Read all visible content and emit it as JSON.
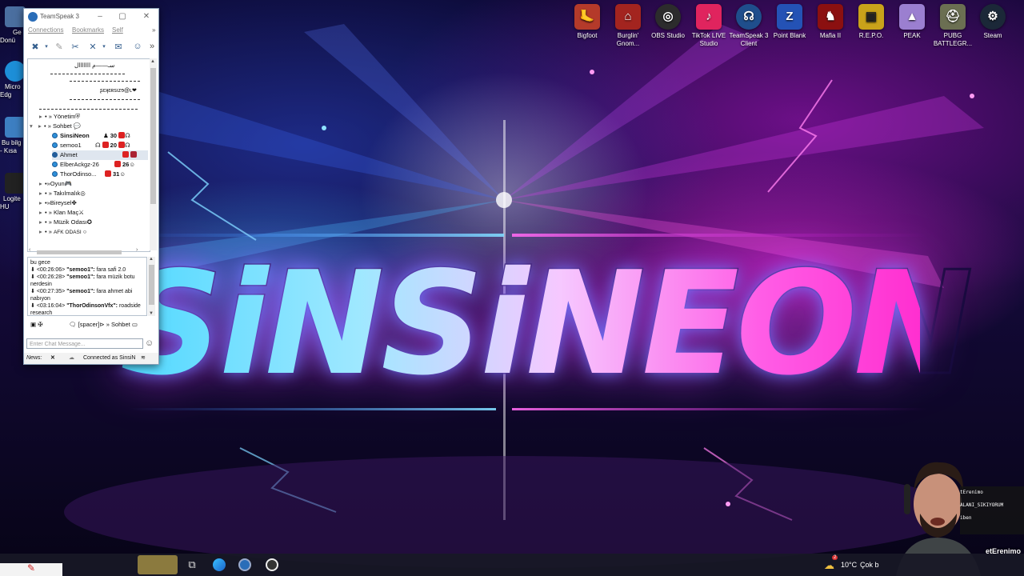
{
  "desktop": {
    "left_icons": [
      {
        "label": "Ge Donü",
        "icon": "app-icon"
      },
      {
        "label": "Micro Edg",
        "icon": "edge-icon"
      },
      {
        "label": "Bu bilg - Kısa",
        "icon": "computer-icon"
      },
      {
        "label": "Logite HU",
        "icon": "logitech-icon"
      }
    ],
    "top_icons": [
      {
        "label": "Bigfoot",
        "icon": "bigfoot-icon",
        "color": "#b43a2a"
      },
      {
        "label": "Burglin' Gnom...",
        "icon": "burglin-gnomes-icon",
        "color": "#a3241f"
      },
      {
        "label": "OBS Studio",
        "icon": "obs-icon",
        "color": "#2c2c2c"
      },
      {
        "label": "TikTok LIVE Studio",
        "icon": "tiktok-icon",
        "color": "#e0245e"
      },
      {
        "label": "TeamSpeak 3 Client",
        "icon": "teamspeak-icon",
        "color": "#1f4e8c"
      },
      {
        "label": "Point Blank",
        "icon": "point-blank-icon",
        "color": "#2452b5"
      },
      {
        "label": "Mafia II",
        "icon": "mafia-icon",
        "color": "#8b1010"
      },
      {
        "label": "R.E.P.O.",
        "icon": "repo-icon",
        "color": "#c9a21a"
      },
      {
        "label": "PEAK",
        "icon": "peak-icon",
        "color": "#9b7fd0"
      },
      {
        "label": "PUBG BATTLEGR...",
        "icon": "pubg-icon",
        "color": "#6b6f52"
      },
      {
        "label": "Steam",
        "icon": "steam-icon",
        "color": "#1b2838"
      }
    ],
    "wallpaper_text": "SiNSiNEON"
  },
  "teamspeak": {
    "title": "TeamSpeak 3",
    "menu": [
      "Connections",
      "Bookmarks",
      "Self"
    ],
    "tree": {
      "banner_lines": [
        "سـ——م ااااااال",
        "ʂɛʞɛʀsızɘ@ʟ❤"
      ],
      "channels": [
        {
          "name": "Yönetim",
          "expanded": false
        },
        {
          "name": "Sohbet",
          "expanded": true
        }
      ],
      "users": [
        {
          "name": "SinsiNeon",
          "count": "30",
          "bold": true
        },
        {
          "name": "semoo1",
          "count": "20",
          "bold": false
        },
        {
          "name": "Ahmet",
          "count": "",
          "bold": false,
          "selected": true
        },
        {
          "name": "ElberAckgz-26",
          "count": "26",
          "bold": false
        },
        {
          "name": "ThorOdinso...",
          "count": "31",
          "bold": false
        }
      ],
      "more_channels": [
        "Oyun",
        "Takılmalık",
        "Bireysel",
        "Klan Maç",
        "Müzik Odası",
        "AFK ODASI"
      ]
    },
    "chat": {
      "lines": [
        {
          "time": "",
          "user": "",
          "text": "bu gece"
        },
        {
          "time": "<00:26:06>",
          "user": "\"semoo1\":",
          "text": "fara safi 2.0"
        },
        {
          "time": "<00:26:28>",
          "user": "\"semoo1\":",
          "text": "fara müzik botu nerdesin"
        },
        {
          "time": "<00:27:35>",
          "user": "\"semoo1\":",
          "text": "fara ahmet abi nabıyon"
        },
        {
          "time": "<03:16:04>",
          "user": "\"ThorOdinsonVfx\":",
          "text": "roadside research"
        }
      ],
      "tab_spacer": "[spacer]",
      "tab_channel": "» Sohbet",
      "input_placeholder": "Enter Chat Message..."
    },
    "status": {
      "news_label": "News:",
      "connection": "Connected as SinsiN"
    }
  },
  "webcam": {
    "overlay_lines": [
      "tErenimo",
      "ALANI_SIKIYORUM",
      "iben"
    ],
    "name_fragment": "etErenimo"
  },
  "taskbar": {
    "weather": "10°C",
    "weather_desc": "Çok b",
    "notification_count": "2"
  }
}
